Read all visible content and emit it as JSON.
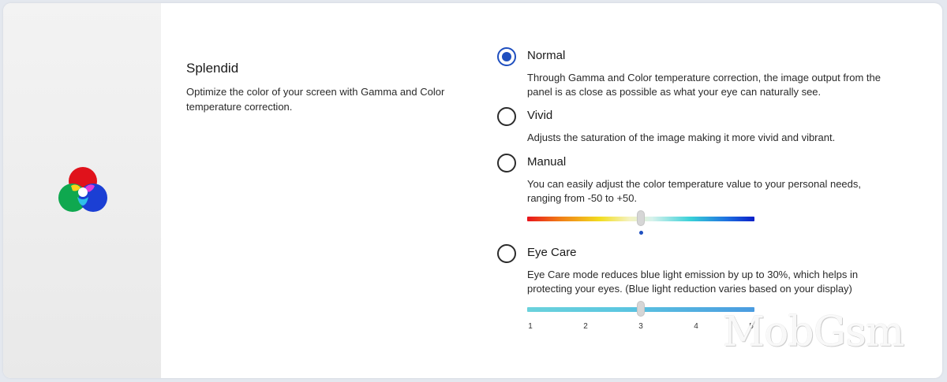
{
  "feature": {
    "title": "Splendid",
    "description": "Optimize the color of your screen with Gamma and Color temperature correction.",
    "icon": "rgb-color-circles-icon"
  },
  "options": [
    {
      "label": "Normal",
      "description": "Through Gamma and Color temperature correction, the image output from the panel is as close as possible as what your eye can naturally see.",
      "selected": true
    },
    {
      "label": "Vivid",
      "description": "Adjusts the saturation of the image making it more vivid and vibrant.",
      "selected": false
    },
    {
      "label": "Manual",
      "description": "You can easily adjust the color temperature value to your personal needs, ranging from -50 to +50.",
      "selected": false
    },
    {
      "label": "Eye Care",
      "description": "Eye Care mode reduces blue light emission by up to 30%, which helps in protecting your eyes. (Blue light reduction varies based on your display)",
      "selected": false
    }
  ],
  "manual_slider": {
    "min": -50,
    "max": 50,
    "value": 0,
    "default": 0
  },
  "eye_care_slider": {
    "min": 1,
    "max": 5,
    "value": 3,
    "ticks": [
      "1",
      "2",
      "3",
      "4",
      "5"
    ]
  },
  "watermark": "MobGsm",
  "colors": {
    "accent": "#1f4fbf"
  }
}
